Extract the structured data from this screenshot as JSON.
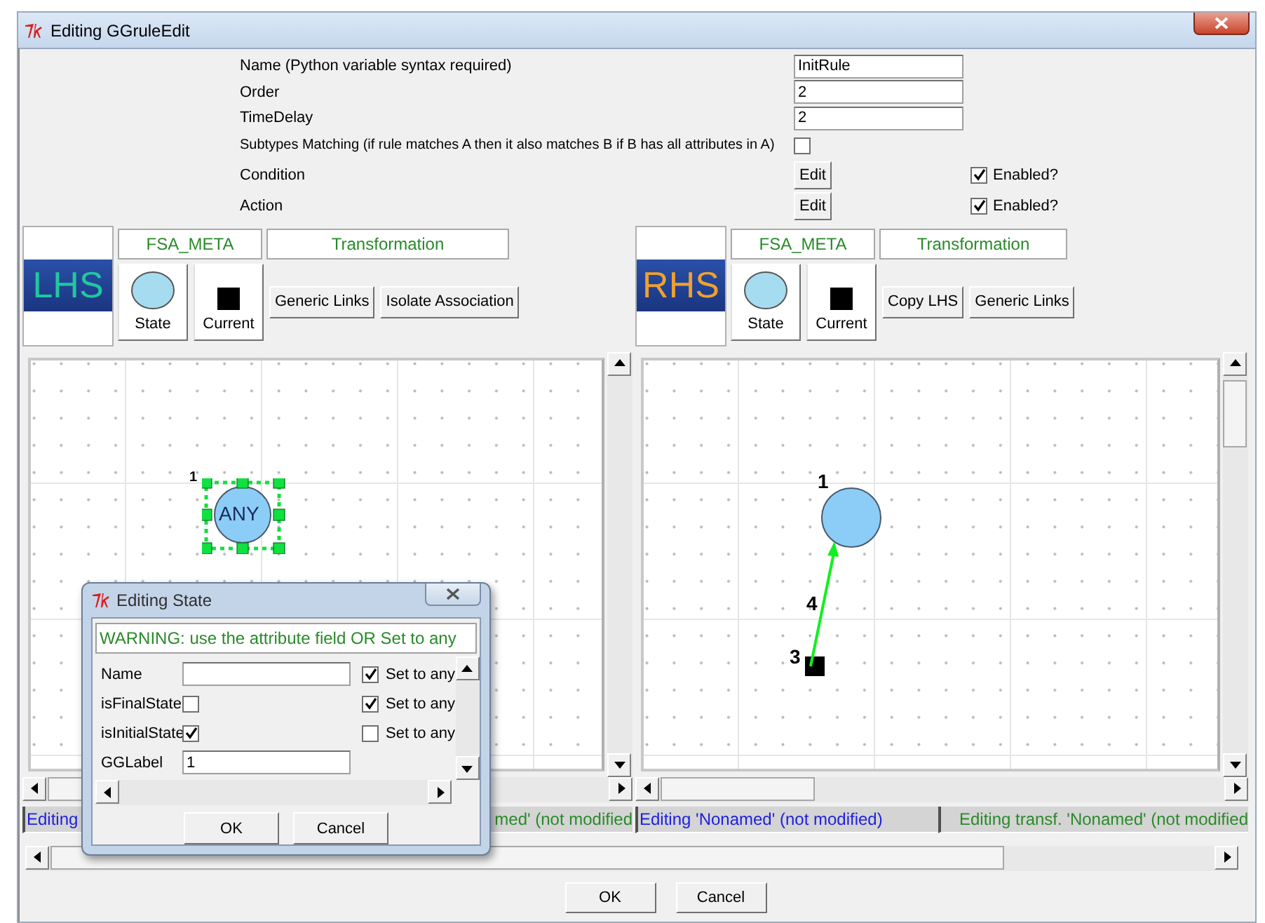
{
  "window": {
    "title": "Editing GGruleEdit"
  },
  "rule_fields": [
    {
      "kind": "text",
      "label": "Name (Python variable syntax required)",
      "value": "InitRule"
    },
    {
      "kind": "text",
      "label": "Order",
      "value": "2"
    },
    {
      "kind": "text",
      "label": "TimeDelay",
      "value": "2"
    },
    {
      "kind": "checkbox",
      "label": "Subtypes Matching (if rule matches A then it also matches B if B has all attributes in A)",
      "checked": false
    },
    {
      "kind": "edit",
      "label": "Condition",
      "button": "Edit",
      "enabled_label": "Enabled?",
      "enabled": true
    },
    {
      "kind": "edit",
      "label": "Action",
      "button": "Edit",
      "enabled_label": "Enabled?",
      "enabled": true
    }
  ],
  "panels": [
    {
      "logo": "LHS",
      "tabs": [
        "FSA_META",
        "Transformation"
      ],
      "tools": [
        {
          "kind": "state",
          "label": "State"
        },
        {
          "kind": "current",
          "label": "Current"
        }
      ],
      "buttons": [
        "Generic Links",
        "Isolate Association"
      ],
      "nodes": [
        {
          "kind": "state",
          "number": "1",
          "label": "ANY",
          "selected": true
        }
      ],
      "status": [
        {
          "kind": "graph",
          "text": "Editing"
        },
        {
          "kind": "transformation",
          "text": "med' (not modified"
        }
      ]
    },
    {
      "logo": "RHS",
      "tabs": [
        "FSA_META",
        "Transformation"
      ],
      "tools": [
        {
          "kind": "state",
          "label": "State"
        },
        {
          "kind": "current",
          "label": "Current"
        }
      ],
      "buttons": [
        "Copy LHS",
        "Generic Links"
      ],
      "nodes": [
        {
          "kind": "state",
          "number": "1",
          "selected": false
        },
        {
          "kind": "current",
          "number": "3",
          "selected": false
        },
        {
          "kind": "link",
          "number": "4",
          "selected": false
        }
      ],
      "status": [
        {
          "kind": "graph",
          "text": "Editing 'Nonamed' (not modified)"
        },
        {
          "kind": "transformation",
          "text": "Editing transf. 'Nonamed' (not modified"
        }
      ]
    }
  ],
  "dialog": {
    "title": "Editing State",
    "warning": "WARNING: use the attribute field OR Set to any",
    "rows": [
      {
        "kind": "text",
        "label": "Name",
        "set_to_any": true,
        "set_label": "Set to any"
      },
      {
        "kind": "checkbox",
        "label": "isFinalState",
        "checked": false,
        "set_to_any": true,
        "set_label": "Set to any"
      },
      {
        "kind": "checkbox",
        "label": "isInitialState",
        "checked": true,
        "set_to_any": false,
        "set_label": "Set to any"
      },
      {
        "kind": "text",
        "label": "GGLabel",
        "value": "1"
      }
    ],
    "buttons": [
      "OK",
      "Cancel"
    ]
  },
  "buttons": [
    "OK",
    "Cancel"
  ]
}
